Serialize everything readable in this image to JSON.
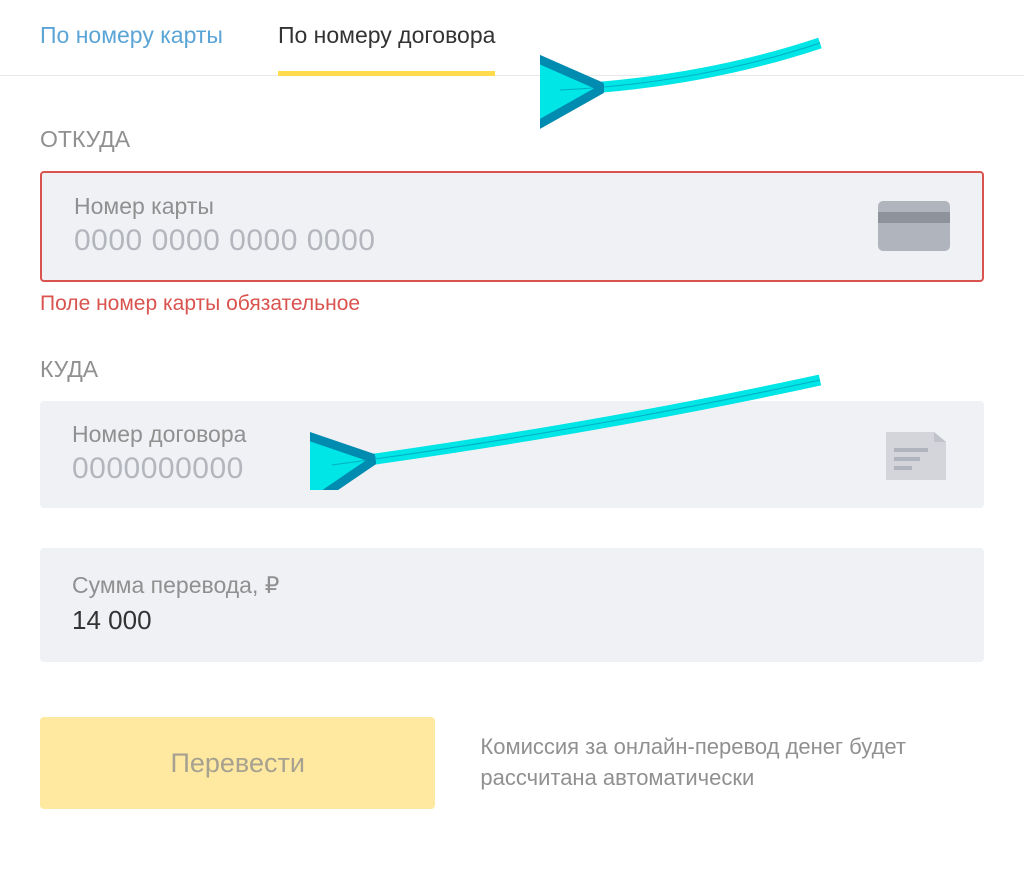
{
  "tabs": {
    "by_card": "По номеру карты",
    "by_contract": "По номеру договора"
  },
  "from": {
    "label": "ОТКУДА",
    "input_label": "Номер карты",
    "placeholder": "0000 0000 0000 0000",
    "error": "Поле номер карты обязательное"
  },
  "to": {
    "label": "КУДА",
    "input_label": "Номер договора",
    "placeholder": "0000000000"
  },
  "amount": {
    "label": "Сумма перевода, ₽",
    "value": "14 000"
  },
  "transfer_button": "Перевести",
  "commission_note": "Комиссия за онлайн-перевод денег будет рассчитана автоматически",
  "colors": {
    "accent_yellow": "#ffdb4d",
    "error_red": "#d9534f",
    "annotation_cyan": "#00e5e5"
  }
}
